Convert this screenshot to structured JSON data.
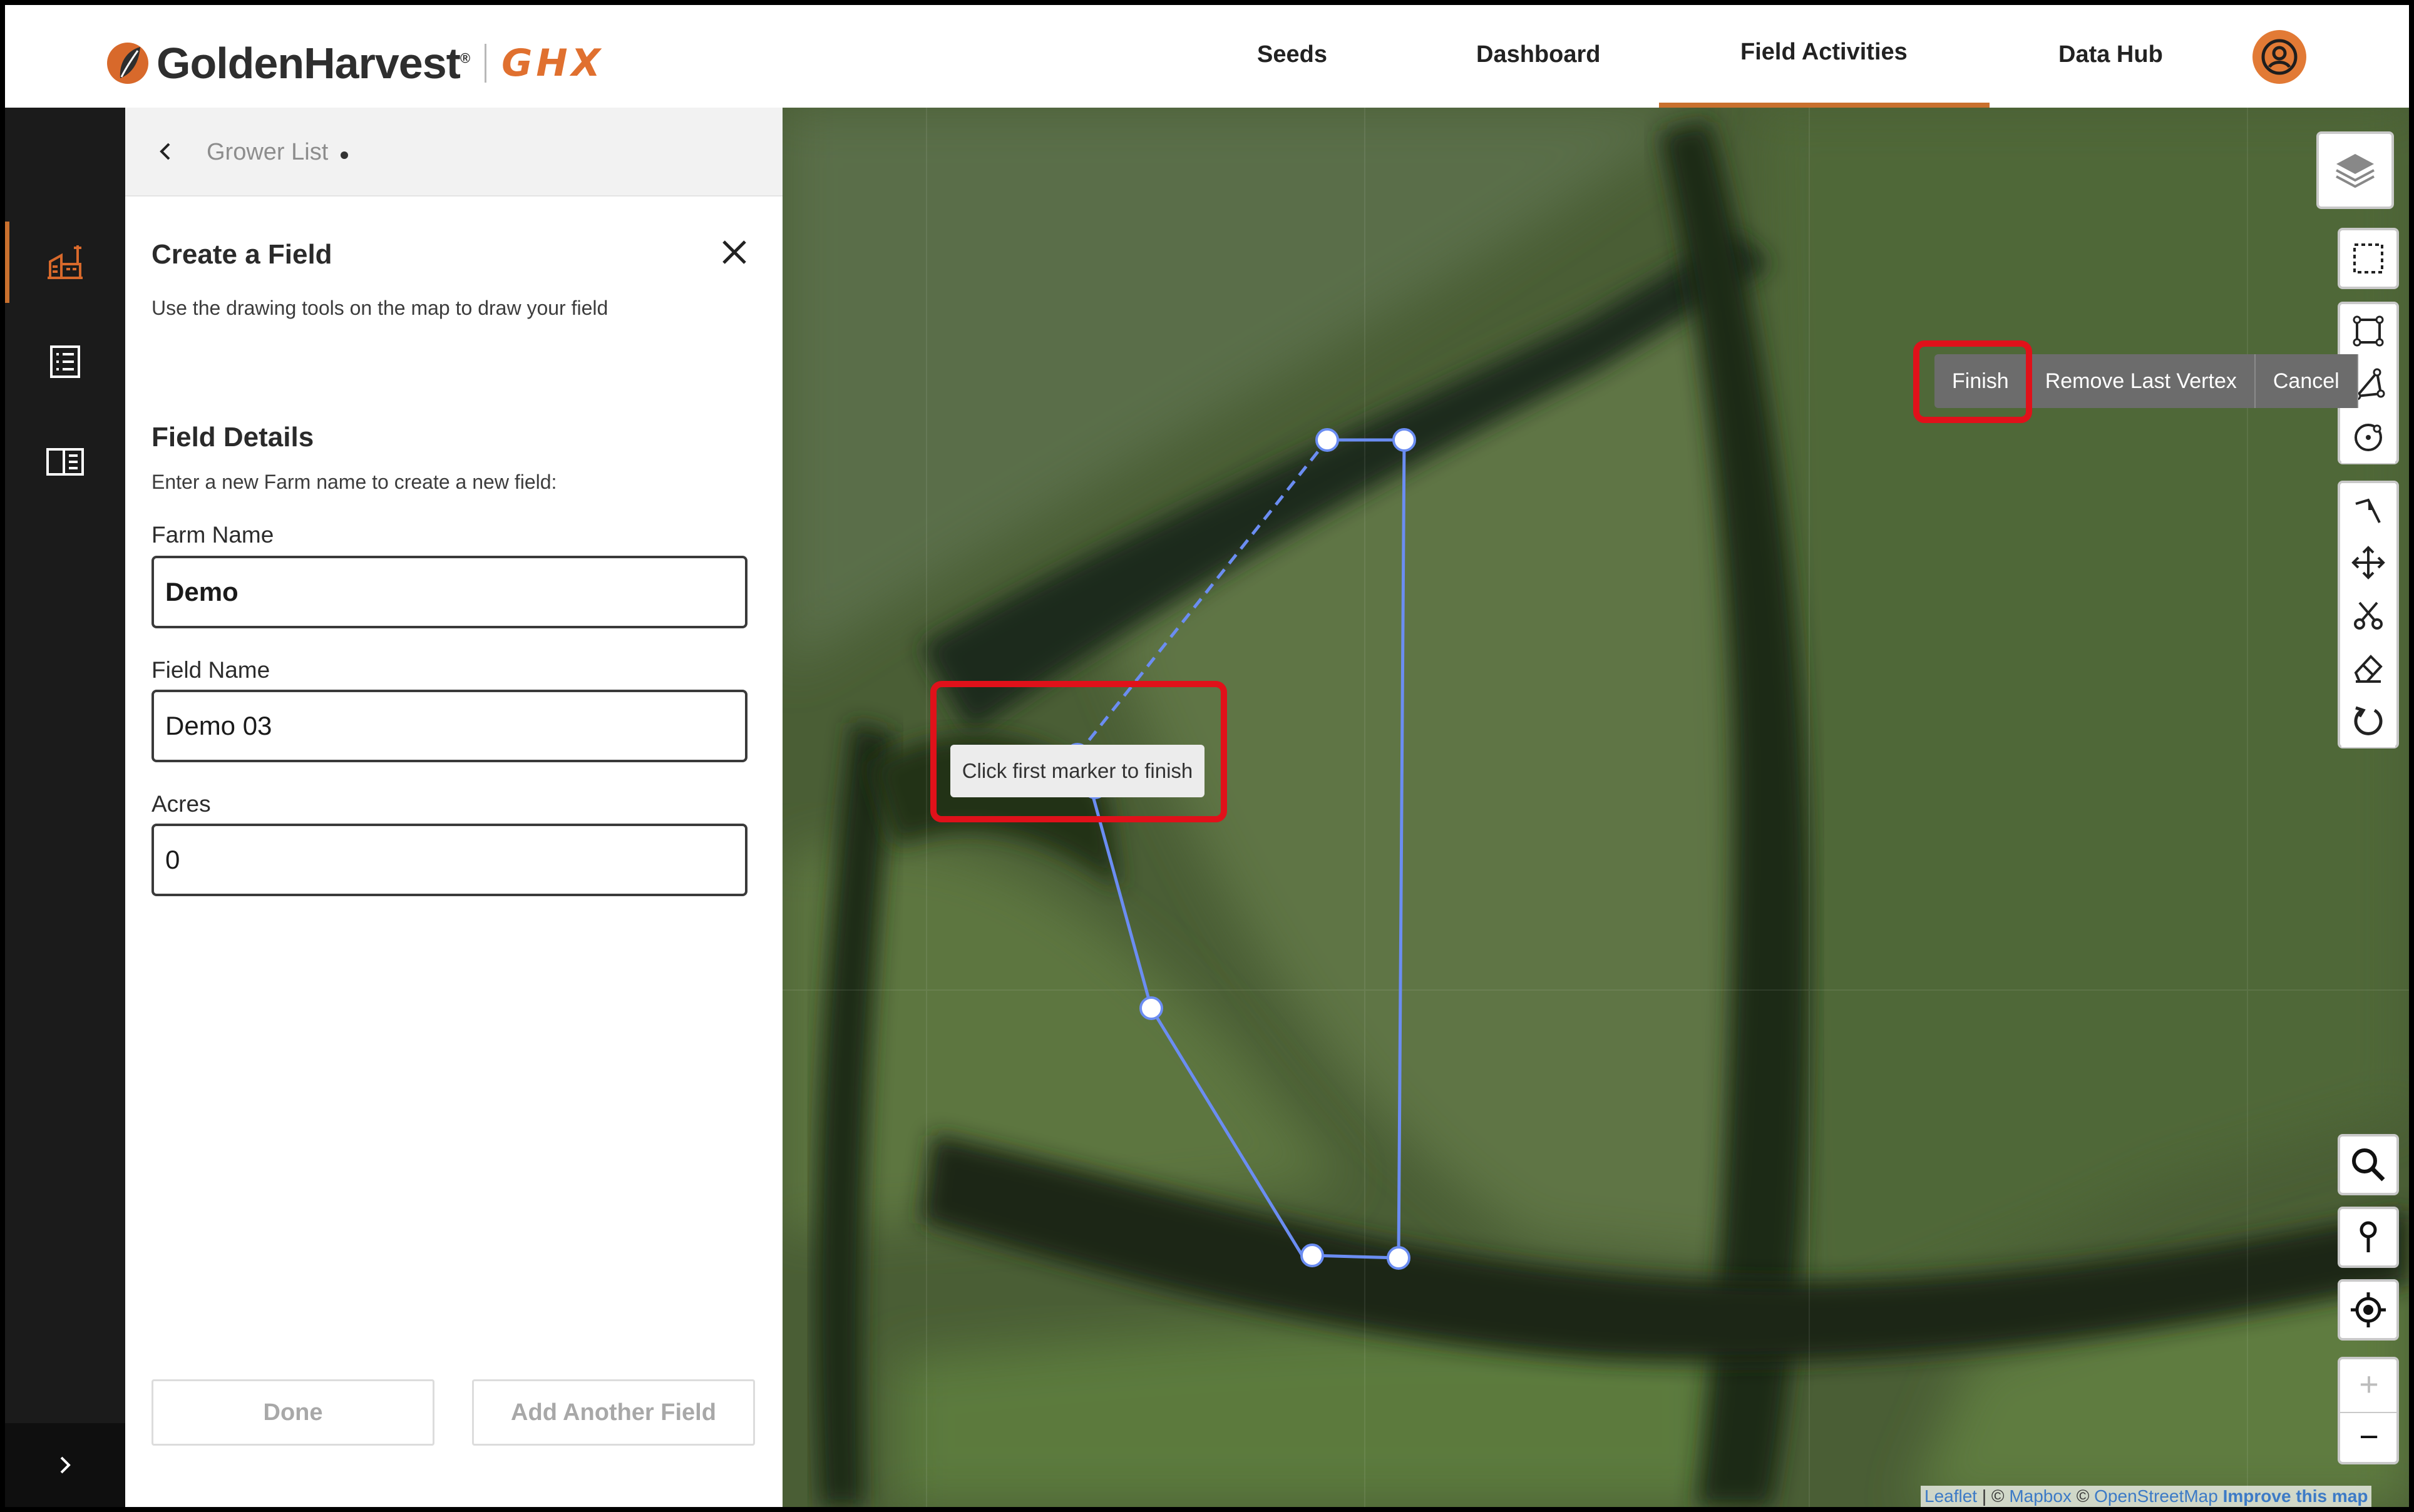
{
  "header": {
    "brand_name": "GoldenHarvest",
    "brand_reg": "®",
    "brand_sub": "GHX",
    "nav": [
      "Seeds",
      "Dashboard",
      "Field Activities",
      "Data Hub"
    ],
    "active_nav": "Field Activities",
    "accent_color": "#c9702e"
  },
  "panel": {
    "breadcrumb": "Grower List",
    "title": "Create a Field",
    "description": "Use the drawing tools on the map to draw your field",
    "section_title": "Field Details",
    "section_sub": "Enter a new Farm name to create a new field:",
    "farm_label": "Farm Name",
    "farm_value": "Demo",
    "field_label": "Field Name",
    "field_value": "Demo 03",
    "acres_label": "Acres",
    "acres_value": "0",
    "done_label": "Done",
    "add_label": "Add Another Field"
  },
  "map": {
    "draw_actions": [
      "Finish",
      "Remove Last Vertex",
      "Cancel"
    ],
    "tooltip": "Click first marker to finish",
    "highlight_color": "#e0111a",
    "polygon_color": "#6b8df2",
    "attribution": {
      "leaflet": "Leaflet",
      "sep1": " | © ",
      "mapbox": "Mapbox",
      "sep2": " © ",
      "osm": "OpenStreetMap",
      "improve": "Improve this map"
    }
  }
}
